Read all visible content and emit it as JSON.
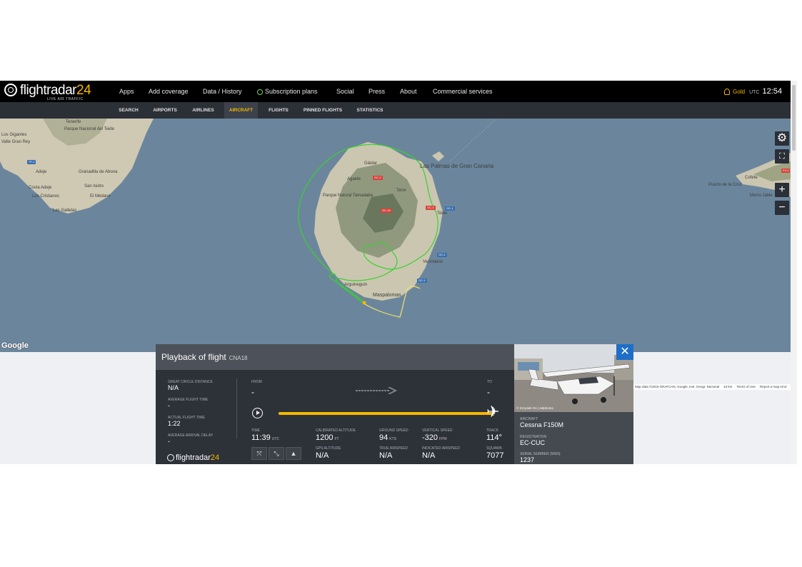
{
  "brand": {
    "name_a": "flightradar",
    "name_b": "24",
    "tagline": "LIVE AIR TRAFFIC"
  },
  "nav": {
    "main": [
      "Apps",
      "Add coverage",
      "Data / History",
      "Subscription plans",
      "Social",
      "Press",
      "About",
      "Commercial services"
    ],
    "sub": [
      "SEARCH",
      "AIRPORTS",
      "AIRLINES",
      "AIRCRAFT",
      "FLIGHTS",
      "PINNED FLIGHTS",
      "STATISTICS"
    ],
    "active_sub": "AIRCRAFT"
  },
  "account": {
    "plan": "Gold",
    "tz": "UTC",
    "clock": "12:54"
  },
  "map": {
    "labels": [
      "Las Palmas de Gran Canaria",
      "Parque Natural Tamadaba",
      "Maspalomas",
      "Agaete",
      "Gáldar",
      "Teror",
      "Telde",
      "Vecindario",
      "Arguineguín",
      "Tenerife",
      "Parque Nacional del Teide",
      "Los Gigantes",
      "Adeje",
      "Costa Adeje",
      "Los Cristianos",
      "El Médano",
      "Las Galletas",
      "Granadilla de Abona",
      "Puerto de la Cruz",
      "Morro Jable",
      "Cofete",
      "San Isidro",
      "Valle Gran Rey"
    ],
    "google": "Google",
    "attribution": [
      "Map data ©2019 GRAFCAN, Google, Inst. Geogr. Nacional",
      "10 km",
      "Terms of Use",
      "Report a map error"
    ],
    "controls": {
      "settings": "settings-icon",
      "fullscreen": "fullscreen-icon",
      "zoom_in": "+",
      "zoom_out": "−"
    }
  },
  "playback": {
    "title": "Playback of flight",
    "callsign": "CNA18",
    "great_circle_label": "GREAT CIRCLE DISTANCE",
    "great_circle": "N/A",
    "avg_time_label": "AVERAGE FLIGHT TIME",
    "avg_time": "-",
    "actual_time_label": "ACTUAL FLIGHT TIME",
    "actual_time": "1:22",
    "arrival_delay_label": "AVERAGE ARRIVAL DELAY",
    "arrival_delay": "-",
    "from_label": "FROM",
    "from": "-",
    "to_label": "TO",
    "to": "-",
    "progress": 1.0,
    "time_label": "TIME",
    "time": "11:39",
    "time_unit": "UTC",
    "cal_alt_label": "CALIBRATED ALTITUDE",
    "cal_alt": "1200",
    "cal_alt_unit": "FT",
    "ground_speed_label": "GROUND SPEED",
    "ground_speed": "94",
    "ground_speed_unit": "KTS",
    "vertical_speed_label": "VERTICAL SPEED",
    "vertical_speed": "-320",
    "vertical_speed_unit": "FPM",
    "track_label": "TRACK",
    "track": "114°",
    "gps_alt_label": "GPS ALTITUDE",
    "gps_alt": "N/A",
    "tas_label": "TRUE AIRSPEED",
    "tas": "N/A",
    "ias_label": "INDICATED AIRSPEED",
    "ias": "N/A",
    "squawk_label": "SQUAWK",
    "squawk": "7077",
    "footer_logo_a": "flightradar",
    "footer_logo_b": "24"
  },
  "aircraft": {
    "photo_credit": "© Krzysiek Os | Jetphotos",
    "aircraft_label": "AIRCRAFT",
    "aircraft": "Cessna F150M",
    "registration_label": "REGISTRATION",
    "registration": "EC-CUC",
    "serial_label": "SERIAL NUMBER (MSN)",
    "serial": "1237"
  },
  "colors": {
    "accent": "#f5b700",
    "track_green": "#39d12f",
    "track_yellow": "#f3e06a",
    "sea": "#6b869c",
    "close": "#1e6ec8"
  }
}
